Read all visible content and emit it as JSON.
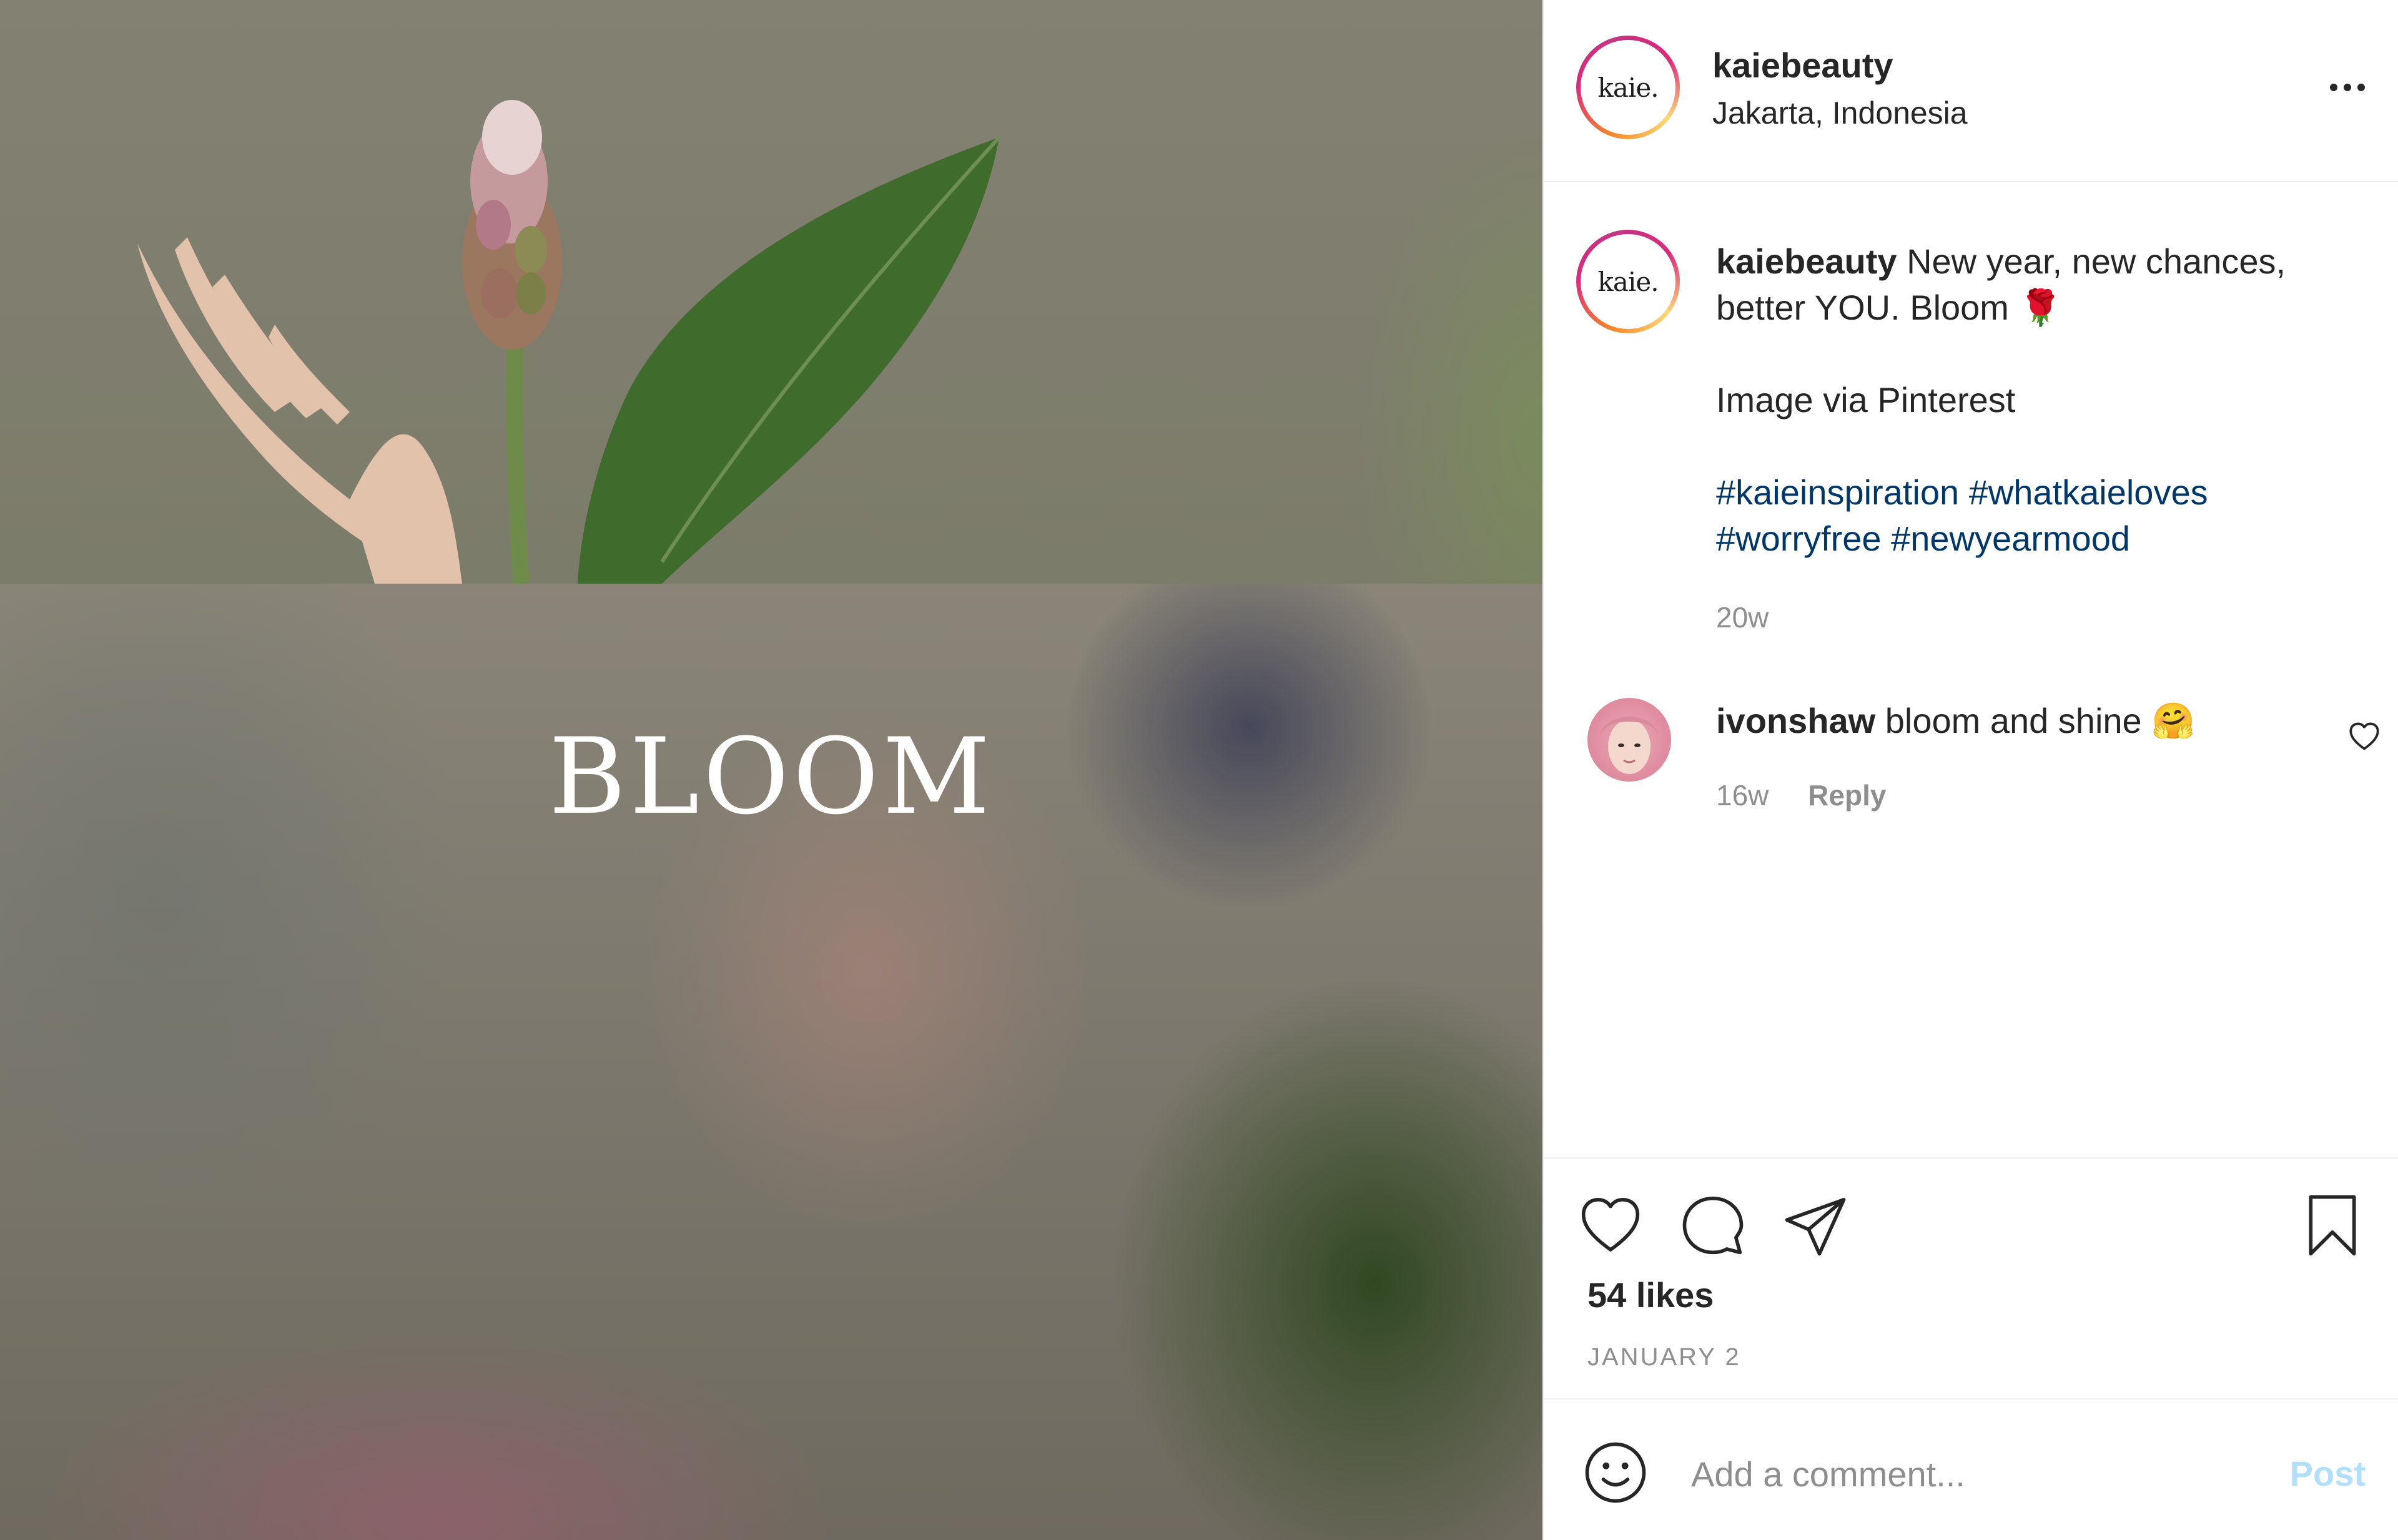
{
  "post": {
    "image_overlay_text": "BLOOM"
  },
  "header": {
    "avatar_logo": "kaie.",
    "username": "kaiebeauty",
    "location": "Jakarta, Indonesia",
    "more_icon": "ellipsis-icon"
  },
  "caption": {
    "avatar_logo": "kaie.",
    "username": "kaiebeauty",
    "text_line1": "New year, new chances,",
    "text_line2": "better YOU. Bloom",
    "emoji": "🌹",
    "credit": "Image via Pinterest",
    "hashtags_line1": [
      "#kaieinspiration",
      "#whatkaieloves"
    ],
    "hashtags_line2": [
      "#worryfree",
      "#newyearmood"
    ],
    "timestamp": "20w"
  },
  "comments": [
    {
      "username": "ivonshaw",
      "text": "bloom and shine",
      "emoji": "🤗",
      "timestamp": "16w",
      "reply_label": "Reply"
    }
  ],
  "actions": {
    "icons": [
      "heart-icon",
      "comment-icon",
      "share-icon",
      "bookmark-icon"
    ],
    "likes": "54 likes",
    "date": "JANUARY 2"
  },
  "add_comment": {
    "placeholder": "Add a comment...",
    "post_label": "Post"
  },
  "colors": {
    "hashtag": "#00376b",
    "muted": "#8e8e8e",
    "post_button_disabled": "#b2dffc",
    "text": "#262626"
  }
}
